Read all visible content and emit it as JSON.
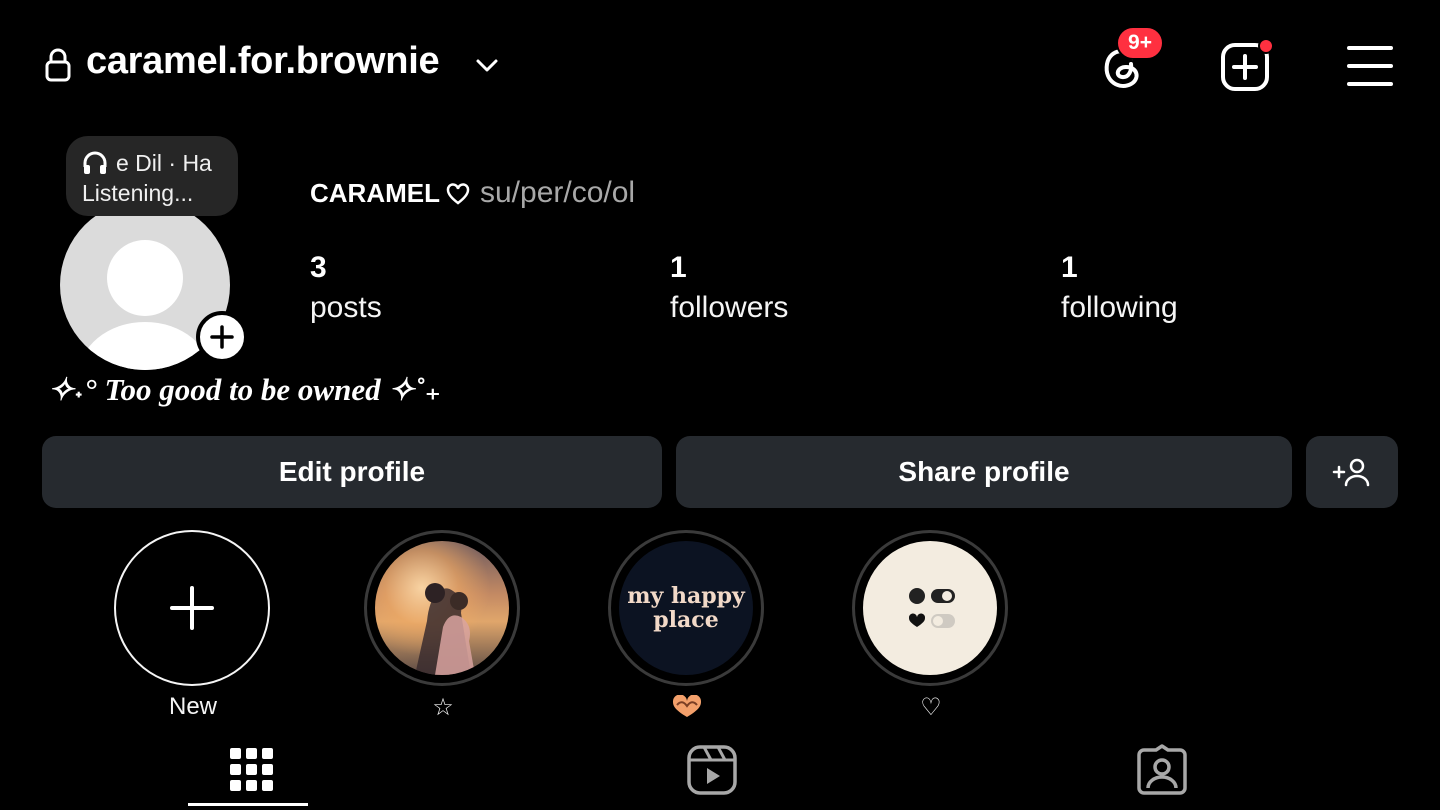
{
  "header": {
    "username": "caramel.for.brownie",
    "threads_badge": "9+",
    "icons": [
      "lock-icon",
      "chevron-down-icon",
      "threads-icon",
      "create-icon",
      "menu-icon"
    ]
  },
  "note": {
    "song": "e Dil · Ha",
    "status": "Listening..."
  },
  "profile": {
    "display_name": "CARAMEL",
    "pronouns": "su/per/co/ol",
    "bio": "✧˖° Too good to be owned ✧˚₊"
  },
  "stats": [
    {
      "count": "3",
      "label": "posts"
    },
    {
      "count": "1",
      "label": "followers"
    },
    {
      "count": "1",
      "label": "following"
    }
  ],
  "actions": {
    "edit": "Edit profile",
    "share": "Share profile"
  },
  "highlights": [
    {
      "label": "New",
      "cover": "plus"
    },
    {
      "label": "☆",
      "cover": "photo"
    },
    {
      "label": "",
      "cover": "text",
      "cover_text": [
        "my happy",
        "place"
      ],
      "label_icon": "heart-hands-icon"
    },
    {
      "label": "♡",
      "cover": "toggles"
    }
  ],
  "tabs": [
    "grid-icon",
    "reels-icon",
    "tagged-icon"
  ],
  "colors": {
    "background": "#000000",
    "button": "#262a2f",
    "badge": "#ff3040",
    "muted_text": "#a8a8a8"
  }
}
